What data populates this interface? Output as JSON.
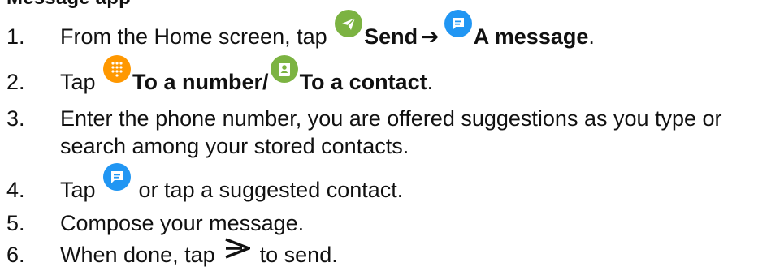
{
  "heading": "Message app",
  "colors": {
    "send_green": "#7cb342",
    "message_blue": "#2196f3",
    "dialpad_orange": "#ff9800",
    "contact_green": "#7cb342"
  },
  "steps": [
    {
      "num": "1.",
      "pre": "From the Home screen, tap ",
      "send_label": "Send",
      "arrow": "➔",
      "message_label": "A message",
      "end": ".",
      "icons": [
        "send-icon",
        "message-icon"
      ]
    },
    {
      "num": "2.",
      "pre": "Tap ",
      "number_label": "To a number/",
      "contact_label": "To a contact",
      "end": ".",
      "icons": [
        "dialpad-icon",
        "contact-icon"
      ]
    },
    {
      "num": "3.",
      "line1": "Enter the phone number, you are offered suggestions as you type or",
      "line2": "search among your stored contacts."
    },
    {
      "num": "4.",
      "pre": "Tap ",
      "post": " or tap a suggested contact.",
      "icons": [
        "message-icon"
      ]
    },
    {
      "num": "5.",
      "text": "Compose your message."
    },
    {
      "num": "6.",
      "pre": "When done, tap ",
      "post": " to send.",
      "icons": [
        "send-arrow-icon"
      ]
    }
  ]
}
